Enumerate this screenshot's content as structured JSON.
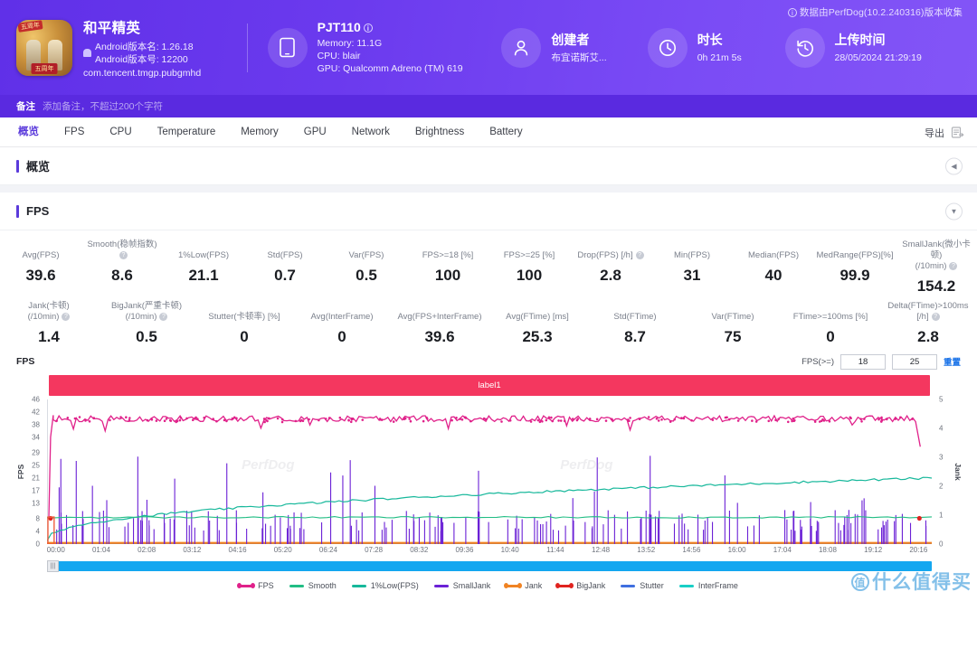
{
  "header": {
    "collect_note": "数据由PerfDog(10.2.240316)版本收集",
    "app": {
      "name": "和平精英",
      "version_name": "Android版本名: 1.26.18",
      "version_code": "Android版本号: 12200",
      "package": "com.tencent.tmgp.pubgmhd",
      "icon_ribbon": "五周年",
      "icon_badge": "五周年"
    },
    "device": {
      "title": "PJT110",
      "memory": "Memory: 11.1G",
      "cpu": "CPU: blair",
      "gpu": "GPU: Qualcomm Adreno (TM) 619",
      "icon": "phone-icon"
    },
    "creator": {
      "title": "创建者",
      "value": "布宜诺斯艾...",
      "icon": "user-icon"
    },
    "duration": {
      "title": "时长",
      "value": "0h 21m 5s",
      "icon": "clock-icon"
    },
    "upload": {
      "title": "上传时间",
      "value": "28/05/2024 21:29:19",
      "icon": "history-icon"
    }
  },
  "note": {
    "label": "备注",
    "placeholder": "添加备注，不超过200个字符"
  },
  "tabs": [
    {
      "label": "概览",
      "active": true
    },
    {
      "label": "FPS",
      "active": false
    },
    {
      "label": "CPU",
      "active": false
    },
    {
      "label": "Temperature",
      "active": false
    },
    {
      "label": "Memory",
      "active": false
    },
    {
      "label": "GPU",
      "active": false
    },
    {
      "label": "Network",
      "active": false
    },
    {
      "label": "Brightness",
      "active": false
    },
    {
      "label": "Battery",
      "active": false
    }
  ],
  "export": {
    "label": "导出",
    "icon": "export-icon"
  },
  "sections": {
    "overview": {
      "title": "概览",
      "chevron": "chevron-left-icon"
    },
    "fps": {
      "title": "FPS",
      "chevron": "chevron-down-icon"
    }
  },
  "metrics": {
    "row1": [
      {
        "label": "Avg(FPS)",
        "value": "39.6",
        "help": false
      },
      {
        "label": "Smooth(稳帧指数)",
        "value": "8.6",
        "help": true
      },
      {
        "label": "1%Low(FPS)",
        "value": "21.1",
        "help": false
      },
      {
        "label": "Std(FPS)",
        "value": "0.7",
        "help": false
      },
      {
        "label": "Var(FPS)",
        "value": "0.5",
        "help": false
      },
      {
        "label": "FPS>=18 [%]",
        "value": "100",
        "help": false
      },
      {
        "label": "FPS>=25 [%]",
        "value": "100",
        "help": false
      },
      {
        "label": "Drop(FPS) [/h]",
        "value": "2.8",
        "help": true
      },
      {
        "label": "Min(FPS)",
        "value": "31",
        "help": false
      },
      {
        "label": "Median(FPS)",
        "value": "40",
        "help": false
      },
      {
        "label": "MedRange(FPS)[%]",
        "value": "99.9",
        "help": false
      },
      {
        "label": "SmallJank(微小卡顿)",
        "label2": "(/10min)",
        "value": "154.2",
        "help": true
      }
    ],
    "row2": [
      {
        "label": "Jank(卡顿)",
        "label2": "(/10min)",
        "value": "1.4",
        "help": true
      },
      {
        "label": "BigJank(严重卡顿)",
        "label2": "(/10min)",
        "value": "0.5",
        "help": true
      },
      {
        "label": "Stutter(卡顿率) [%]",
        "value": "0",
        "help": false
      },
      {
        "label": "Avg(InterFrame)",
        "value": "0",
        "help": false
      },
      {
        "label": "Avg(FPS+InterFrame)",
        "value": "39.6",
        "help": false
      },
      {
        "label": "Avg(FTime) [ms]",
        "value": "25.3",
        "help": false
      },
      {
        "label": "Std(FTime)",
        "value": "8.7",
        "help": false
      },
      {
        "label": "Var(FTime)",
        "value": "75",
        "help": false
      },
      {
        "label": "FTime>=100ms [%]",
        "value": "0",
        "help": false
      },
      {
        "label": "Delta(FTime)>100ms [/h]",
        "value": "2.8",
        "help": true
      }
    ]
  },
  "chart_panel": {
    "top_label": "FPS",
    "fps_ctl_label": "FPS(>=)",
    "threshold_low": "18",
    "threshold_high": "25",
    "reset_label": "重置",
    "band_label": "label1",
    "scroll_grip": "scroll-grip-icon"
  },
  "watermark": {
    "text": "什么值得买",
    "badge": "值",
    "chart": "PerfDog"
  },
  "chart_data": {
    "type": "line",
    "title": "FPS",
    "xlabel": "",
    "ylabel": "FPS",
    "y2label": "Jank",
    "grid": false,
    "legend_position": "bottom",
    "ylim": [
      0,
      46
    ],
    "y2lim": [
      0,
      5
    ],
    "yticks": [
      0,
      4,
      8,
      13,
      17,
      21,
      25,
      29,
      34,
      38,
      42,
      46
    ],
    "y2ticks": [
      0,
      1,
      2,
      3,
      4,
      5
    ],
    "xticks": [
      "00:00",
      "01:04",
      "02:08",
      "03:12",
      "04:16",
      "05:20",
      "06:24",
      "07:28",
      "08:32",
      "09:36",
      "10:40",
      "11:44",
      "12:48",
      "13:52",
      "14:56",
      "16:00",
      "17:04",
      "18:08",
      "19:12",
      "20:16"
    ],
    "legend": [
      {
        "name": "FPS",
        "color": "#e0218a",
        "style": "dotted-line"
      },
      {
        "name": "Smooth",
        "color": "#21bd84",
        "style": "line"
      },
      {
        "name": "1%Low(FPS)",
        "color": "#17b89b",
        "style": "line"
      },
      {
        "name": "SmallJank",
        "color": "#6b21d6",
        "style": "line"
      },
      {
        "name": "Jank",
        "color": "#f08323",
        "style": "dotted-line"
      },
      {
        "name": "BigJank",
        "color": "#e0231f",
        "style": "dotted-line"
      },
      {
        "name": "Stutter",
        "color": "#3f6fe0",
        "style": "line"
      },
      {
        "name": "InterFrame",
        "color": "#19cfc6",
        "style": "line"
      }
    ],
    "series": [
      {
        "name": "FPS",
        "color": "#e0218a",
        "approx_level": 40,
        "range": [
          31,
          42
        ],
        "note": "dense dotted band near 40 fps across full duration, dips to ~34 at start and ~31 at end"
      },
      {
        "name": "Smooth",
        "color": "#21bd84",
        "approx_level": 8.6,
        "note": "near-flat line around 8.6"
      },
      {
        "name": "1%Low(FPS)",
        "color": "#17b89b",
        "range": [
          1,
          21
        ],
        "note": "rising curve from ~1 to ~21 over the session"
      },
      {
        "name": "SmallJank",
        "color": "#6b21d6",
        "range": [
          0,
          29
        ],
        "note": "sparse tall vertical spikes, baseline 0"
      },
      {
        "name": "Jank",
        "color": "#f08323",
        "range": [
          0,
          1
        ],
        "note": "orange baseline near 0 with occasional marks"
      },
      {
        "name": "BigJank",
        "color": "#e0231f",
        "range": [
          0,
          1
        ],
        "note": "red markers near start and end"
      },
      {
        "name": "Stutter",
        "color": "#3f6fe0",
        "approx_level": 0,
        "note": "flat at 0"
      },
      {
        "name": "InterFrame",
        "color": "#19cfc6",
        "approx_level": 0,
        "note": "flat near 0"
      }
    ]
  }
}
